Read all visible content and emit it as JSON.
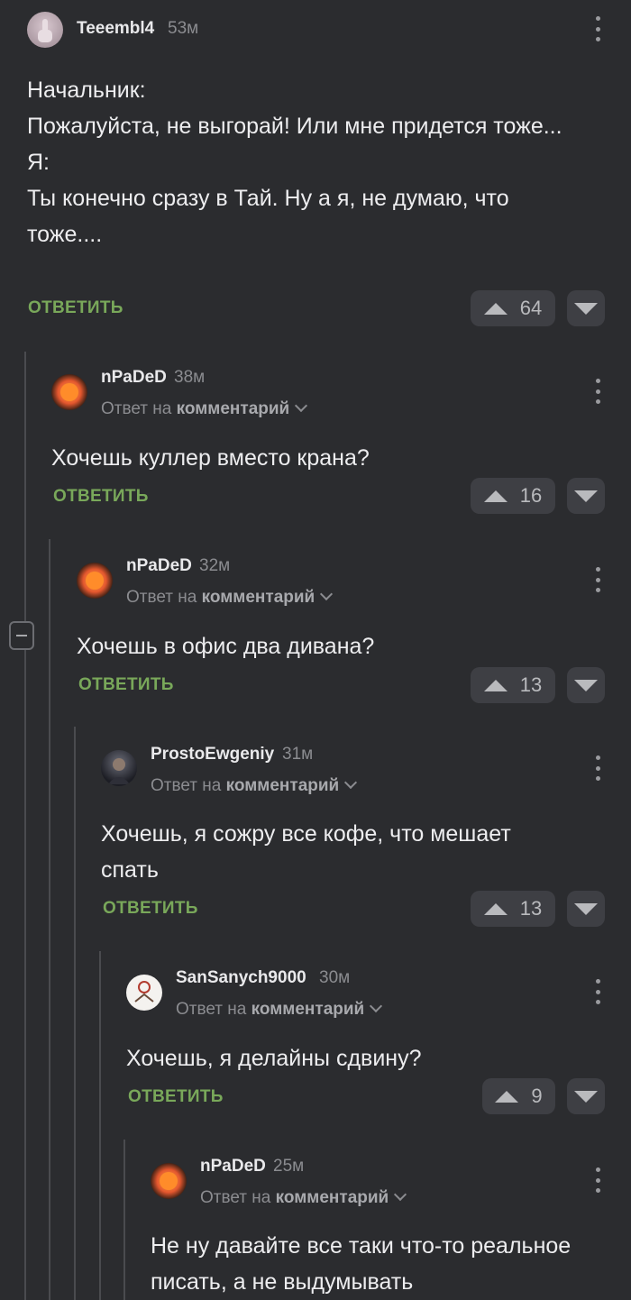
{
  "comments": [
    {
      "username": "Teeembl4",
      "time": "53м",
      "reply_label": "",
      "reply_target": "",
      "text": "Начальник:\nПожалуйста, не выгорай! Или мне придется тоже...\nЯ:\nТы конечно сразу в Тай. Ну а я, не думаю, что тоже....",
      "reply_button": "ОТВЕТИТЬ",
      "votes": "64",
      "avatar": "hand-avatar"
    },
    {
      "username": "nPaDeD",
      "time": "38м",
      "reply_label": "Ответ на",
      "reply_target": "комментарий",
      "text": "Хочешь куллер вместо крана?",
      "reply_button": "ОТВЕТИТЬ",
      "votes": "16",
      "avatar": "sun-avatar"
    },
    {
      "username": "nPaDeD",
      "time": "32м",
      "reply_label": "Ответ на",
      "reply_target": "комментарий",
      "text": "Хочешь в офис два дивана?",
      "reply_button": "ОТВЕТИТЬ",
      "votes": "13",
      "avatar": "sun-avatar"
    },
    {
      "username": "ProstoEwgeniy",
      "time": "31м",
      "reply_label": "Ответ на",
      "reply_target": "комментарий",
      "text": "Хочешь, я сожру все кофе, что мешает спать",
      "reply_button": "ОТВЕТИТЬ",
      "votes": "13",
      "avatar": "person-avatar"
    },
    {
      "username": "SanSanych9000",
      "time": "30м",
      "reply_label": "Ответ на",
      "reply_target": "комментарий",
      "text": "Хочешь, я делайны сдвину?",
      "reply_button": "ОТВЕТИТЬ",
      "votes": "9",
      "avatar": "drawing-avatar"
    },
    {
      "username": "nPaDeD",
      "time": "25м",
      "reply_label": "Ответ на",
      "reply_target": "комментарий",
      "text": "Не ну давайте все таки что-то реальное писать, а не выдумывать",
      "reply_button": "",
      "votes": "",
      "avatar": "sun-avatar"
    }
  ],
  "colors": {
    "background": "#2b2c2f",
    "accent": "#79a85a",
    "muted": "#8b8c90"
  }
}
